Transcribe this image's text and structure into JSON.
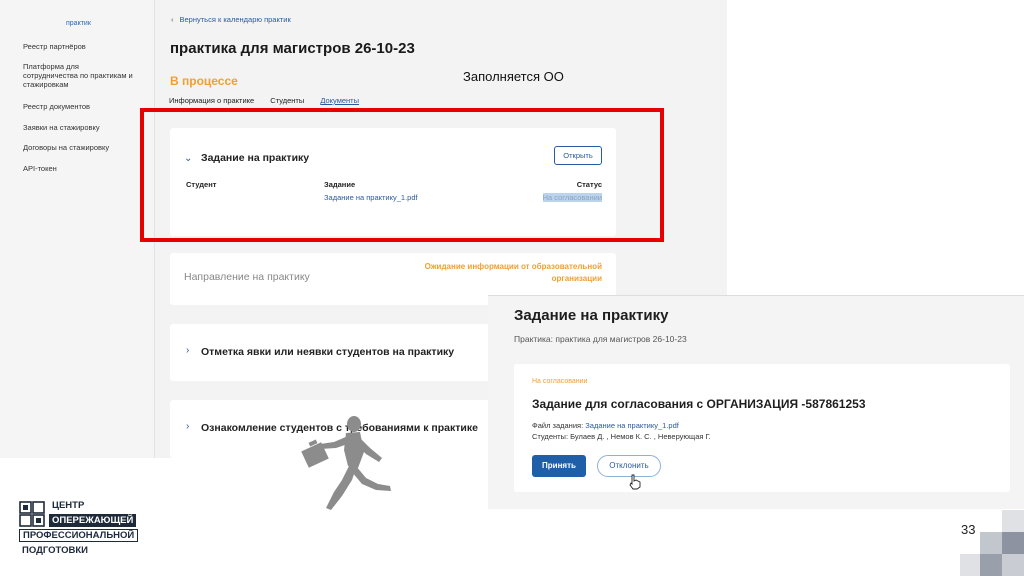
{
  "sidebar": {
    "active_label": "практик",
    "items": [
      {
        "label": "Реестр партнёров"
      },
      {
        "label": "Платформа для сотрудничества по практикам и стажировкам"
      },
      {
        "label": "Реестр документов"
      },
      {
        "label": "Заявки на стажировку"
      },
      {
        "label": "Договоры на стажировку"
      },
      {
        "label": "API-токен"
      }
    ]
  },
  "page": {
    "back_link": "Вернуться к календарю практик",
    "title": "практика для магистров 26-10-23",
    "status": "В процессе",
    "tabs": [
      "Информация о практике",
      "Студенты",
      "Документы"
    ]
  },
  "task_card": {
    "title": "Задание на практику",
    "open_button": "Открыть",
    "col_student": "Студент",
    "col_task": "Задание",
    "col_status": "Статус",
    "task_file": "Задание на практику_1.pdf",
    "status_value": "На согласовании"
  },
  "direction_card": {
    "title": "Направление на практику",
    "note": "Ожидание информации от образовательной организации"
  },
  "attendance_card": {
    "title": "Отметка явки или неявки студентов на практику"
  },
  "familiar_card": {
    "title": "Ознакомление студентов с требованиями к практике"
  },
  "annotation": {
    "label": "Заполняется ОО",
    "frame_color": "#e60000"
  },
  "inset": {
    "title": "Задание на практику",
    "subtitle": "Практика: практика для магистров 26-10-23",
    "badge": "На согласовании",
    "heading": "Задание для согласования с ОРГАНИЗАЦИЯ -587861253",
    "file_label": "Файл задания:",
    "file_link": "Задание на практику_1.pdf",
    "students": "Студенты: Булаев Д. , Немов К. С. , Неверующая Г.",
    "accept_button": "Принять",
    "reject_button": "Отклонить"
  },
  "logo": {
    "line1": "ЦЕНТР",
    "line2": "ОПЕРЕЖАЮЩЕЙ",
    "line3": "ПРОФЕССИОНАЛЬНОЙ",
    "line4": "ПОДГОТОВКИ"
  },
  "page_number": "33",
  "colors": {
    "accent": "#2a5aa0",
    "status_orange": "#f0a030",
    "annotation_red": "#e60000",
    "brand_dark": "#1e2a3a"
  }
}
